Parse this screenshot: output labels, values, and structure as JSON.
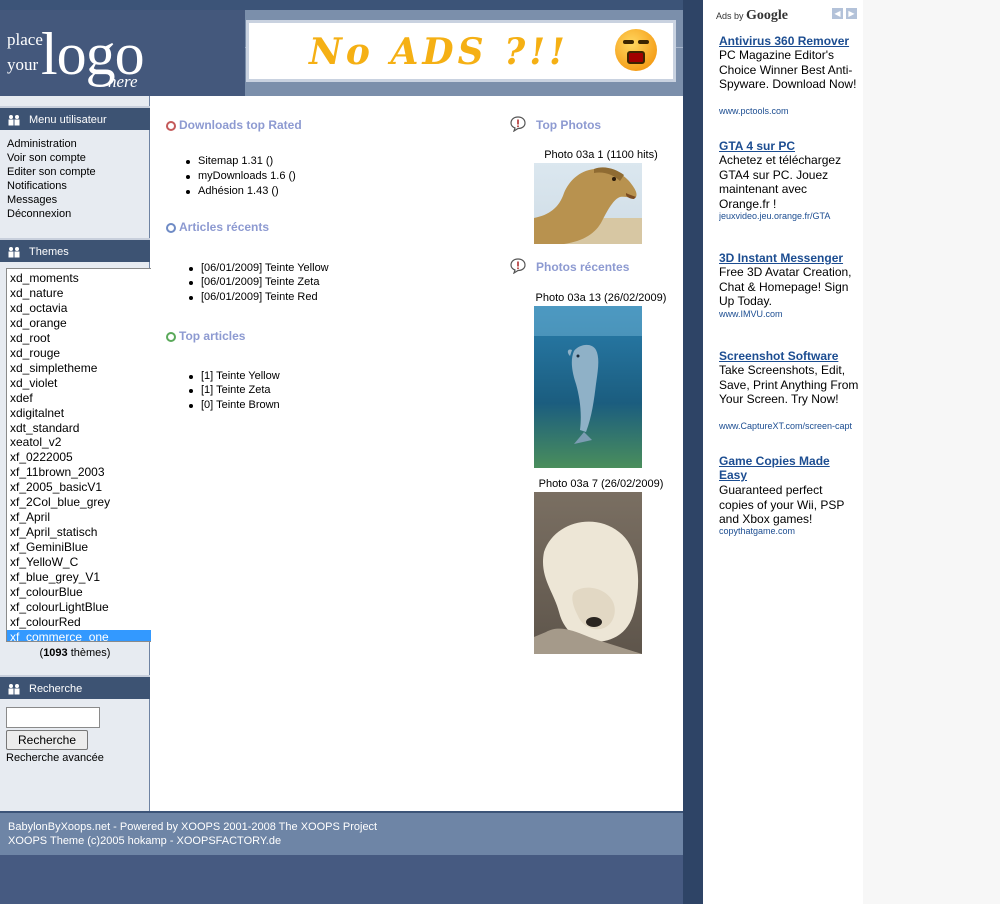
{
  "logo": {
    "place": "place",
    "your": "your",
    "main": "logo",
    "here": "here"
  },
  "banner": {
    "text": "No ADS ?!!"
  },
  "menu": {
    "title": "Menu utilisateur",
    "items": [
      "Administration",
      "Voir son compte",
      "Editer son compte",
      "Notifications",
      "Messages",
      "Déconnexion"
    ]
  },
  "themes": {
    "title": "Themes",
    "items": [
      "xd_moments",
      "xd_nature",
      "xd_octavia",
      "xd_orange",
      "xd_root",
      "xd_rouge",
      "xd_simpletheme",
      "xd_violet",
      "xdef",
      "xdigitalnet",
      "xdt_standard",
      "xeatol_v2",
      "xf_0222005",
      "xf_11brown_2003",
      "xf_2005_basicV1",
      "xf_2Col_blue_grey",
      "xf_April",
      "xf_April_statisch",
      "xf_GeminiBlue",
      "xf_YelloW_C",
      "xf_blue_grey_V1",
      "xf_colourBlue",
      "xf_colourLightBlue",
      "xf_colourRed",
      "xf_commerce_one"
    ],
    "selected": "xf_commerce_one",
    "count_number": "1093",
    "count_suffix": " thèmes)",
    "count_prefix": "("
  },
  "search": {
    "title": "Recherche",
    "button": "Recherche",
    "advanced": "Recherche avancée",
    "value": ""
  },
  "downloads": {
    "title": "Downloads top Rated",
    "items": [
      "Sitemap 1.31 ()",
      "myDownloads 1.6 ()",
      "Adhésion 1.43 ()"
    ]
  },
  "articles_recent": {
    "title": "Articles récents",
    "items": [
      "[06/01/2009] Teinte Yellow",
      "[06/01/2009] Teinte Zeta",
      "[06/01/2009] Teinte Red"
    ]
  },
  "top_articles": {
    "title": "Top articles",
    "items": [
      "[1] Teinte Yellow",
      "[1] Teinte Zeta",
      "[0] Teinte Brown"
    ]
  },
  "top_photos": {
    "title": "Top Photos",
    "items": [
      {
        "caption": "Photo 03a 1 (1100 hits)"
      }
    ]
  },
  "recent_photos": {
    "title": "Photos récentes",
    "items": [
      {
        "caption": "Photo 03a 13 (26/02/2009)"
      },
      {
        "caption": "Photo 03a 7 (26/02/2009)"
      }
    ]
  },
  "footer": {
    "line1": "BabylonByXoops.net - Powered by XOOPS 2001-2008 The XOOPS Project",
    "line2": "XOOPS Theme (c)2005 hokamp - XOOPSFACTORY.de"
  },
  "ads": {
    "label": "Ads by",
    "brand": "Google",
    "items": [
      {
        "title": "Antivirus 360 Remover",
        "desc": "PC Magazine Editor's Choice Winner Best Anti-Spyware. Download Now!",
        "url": "www.pctools.com"
      },
      {
        "title": "GTA 4 sur PC",
        "desc": "Achetez et téléchargez GTA4 sur PC. Jouez maintenant avec Orange.fr !",
        "url": "jeuxvideo.jeu.orange.fr/GTA"
      },
      {
        "title": "3D Instant Messenger",
        "desc": "Free 3D Avatar Creation, Chat & Homepage! Sign Up Today.",
        "url": "www.IMVU.com"
      },
      {
        "title": "Screenshot Software",
        "desc": "Take Screenshots, Edit, Save, Print Anything From Your Screen. Try Now!",
        "url": "www.CaptureXT.com/screen-capt"
      },
      {
        "title": "Game Copies Made Easy",
        "desc": "Guaranteed perfect copies of your Wii, PSP and Xbox games!",
        "url": "copythatgame.com"
      }
    ]
  },
  "colors": {
    "header": "#3c5478",
    "sidebar_title": "#3d5373",
    "section_title": "#8d9ad1",
    "link": "#1c4d91",
    "selected": "#3399ff"
  }
}
